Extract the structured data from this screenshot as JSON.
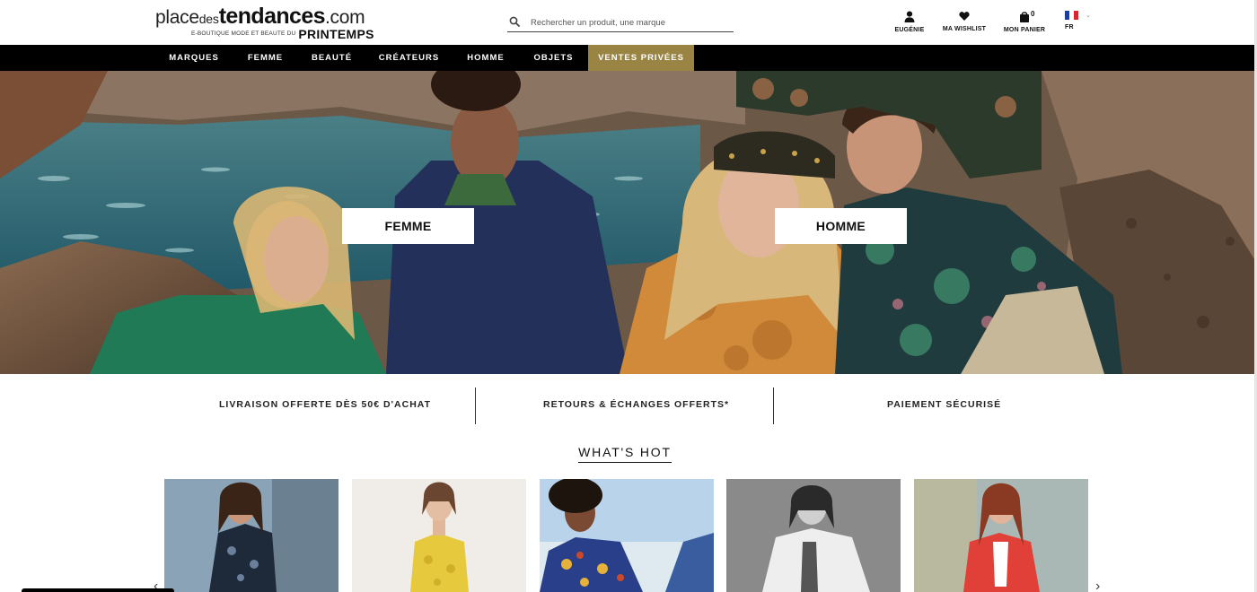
{
  "header": {
    "logo": {
      "place": "place",
      "des": "des",
      "tendances": "tendances",
      "com": ".com",
      "subtitle": "E-BOUTIQUE MODE ET BEAUTE DU",
      "brand": "PRINTEMPS"
    },
    "search": {
      "placeholder": "Rechercher un produit, une marque",
      "value": ""
    },
    "account_label": "EUGÉNIE",
    "wishlist_label": "MA WISHLIST",
    "cart_label": "MON PANIER",
    "cart_count": "0",
    "language_label": "FR"
  },
  "nav": {
    "items": [
      "MARQUES",
      "FEMME",
      "BEAUTÉ",
      "CRÉATEURS",
      "HOMME",
      "OBJETS",
      "VENTES PRIVÉES"
    ]
  },
  "hero": {
    "femme_label": "FEMME",
    "homme_label": "HOMME"
  },
  "benefits": [
    "LIVRAISON OFFERTE DÈS 50€ D'ACHAT",
    "RETOURS & ÉCHANGES OFFERTS*",
    "PAIEMENT SÉCURISÉ"
  ],
  "whats_hot": {
    "title": "WHAT'S HOT"
  },
  "colors": {
    "nav_background": "#000000",
    "ventes_privees_gold": "#9a8443",
    "text": "#111111"
  },
  "icons": [
    "search-icon",
    "user-icon",
    "heart-icon",
    "bag-icon",
    "france-flag-icon",
    "chevron-down-icon",
    "chevron-left-icon",
    "chevron-right-icon"
  ]
}
